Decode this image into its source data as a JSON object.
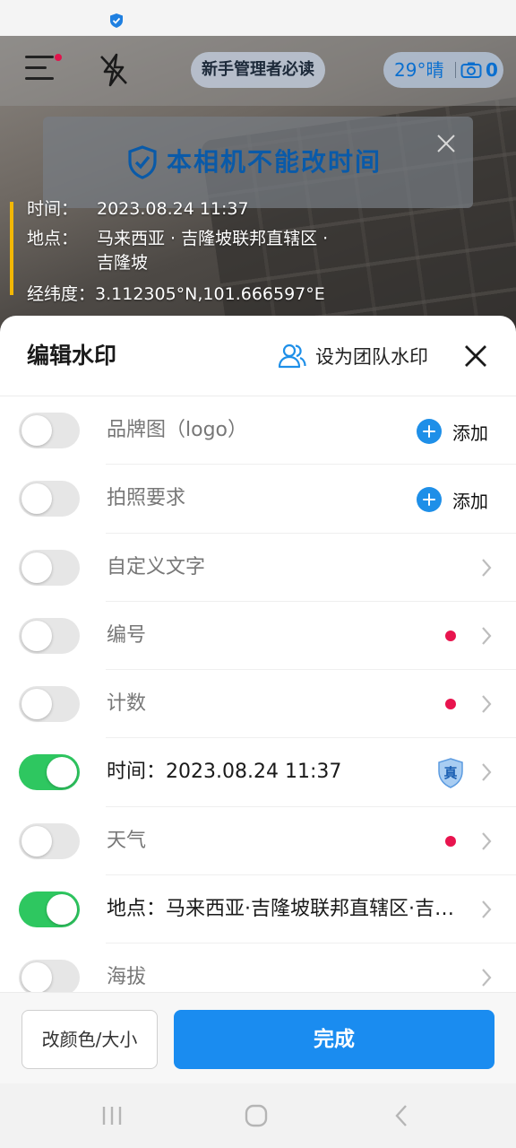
{
  "camera": {
    "guide_label": "新手管理者必读",
    "weather": "29°晴",
    "photo_count": "0",
    "notice_text": "本相机不能改时间",
    "watermark": {
      "time_label": "时间：",
      "time_value": "2023.08.24 11:37",
      "place_label": "地点：",
      "place_value_1": "马来西亚 · 吉隆坡联邦直辖区 ·",
      "place_value_2": "吉隆坡",
      "coord_label": "经纬度：",
      "coord_value": "3.112305°N,101.666597°E"
    }
  },
  "sheet": {
    "title": "编辑水印",
    "team_label": "设为团队水印",
    "rows": [
      {
        "label": "品牌图（logo）",
        "on": false,
        "action": "添加"
      },
      {
        "label": "拍照要求",
        "on": false,
        "action": "添加"
      },
      {
        "label": "自定义文字",
        "on": false
      },
      {
        "label": "编号",
        "on": false,
        "dot": true
      },
      {
        "label": "计数",
        "on": false,
        "dot": true
      },
      {
        "label": "时间：2023.08.24 11:37",
        "on": true,
        "badge": "真"
      },
      {
        "label": "天气",
        "on": false,
        "dot": true
      },
      {
        "label": "地点：马来西亚·吉隆坡联邦直辖区·吉隆坡",
        "on": true
      },
      {
        "label": "海拔",
        "on": false
      }
    ],
    "style_button": "改颜色/大小",
    "done_button": "完成"
  },
  "colors": {
    "accent": "#1a8cf0",
    "toggle_on": "#2ec760",
    "dot": "#e8144e",
    "watermark_bar": "#f2b705"
  }
}
